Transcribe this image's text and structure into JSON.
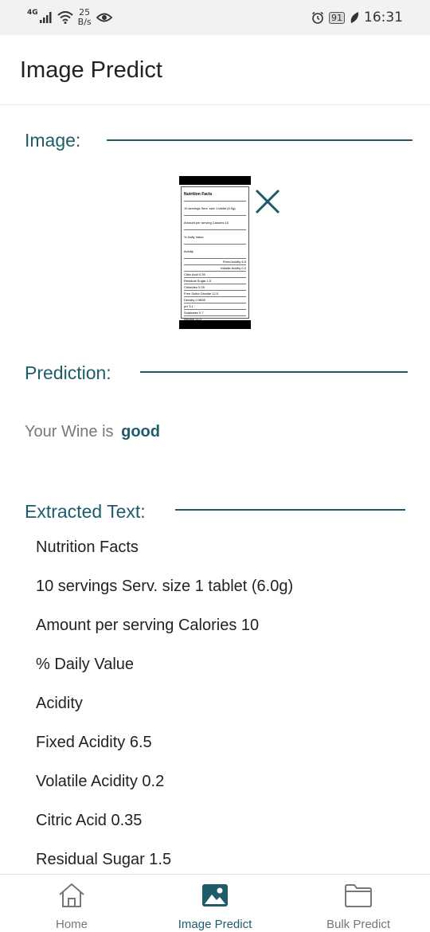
{
  "status_bar": {
    "network": "4G",
    "speed_value": "25",
    "speed_unit": "B/s",
    "battery": "91",
    "time": "16:31"
  },
  "app_bar": {
    "title": "Image Predict"
  },
  "image_section": {
    "title": "Image:",
    "receipt_lines": [
      "Nutrition Facts",
      "10 servings  Serv. size 1 tablet (6.0g)",
      "Amount per serving  Calories  10",
      "% Daily Value",
      "Acidity",
      "Fixed Acidity  6.5",
      "Volatile Acidity  0.2",
      "Citric Acid  0.35",
      "Residual Sugar  1.5",
      "Chlorides  0.05",
      "Free Sulfur Dioxide  12.0",
      "Density  0.9898",
      "pH  3.1",
      "Sulphates  0.7",
      "Alcohol  11.0"
    ]
  },
  "prediction_section": {
    "title": "Prediction:",
    "prefix": "Your Wine is",
    "value": "good"
  },
  "extracted_section": {
    "title": "Extracted Text:",
    "lines": [
      "Nutrition Facts",
      "10 servings Serv. size 1 tablet (6.0g)",
      "Amount per serving Calories 10",
      "% Daily Value",
      "Acidity",
      "Fixed Acidity 6.5",
      "Volatile Acidity 0.2",
      "Citric Acid 0.35",
      "Residual Sugar 1.5"
    ]
  },
  "bottom_nav": {
    "items": [
      {
        "label": "Home",
        "icon": "home-icon",
        "active": false
      },
      {
        "label": "Image Predict",
        "icon": "image-icon",
        "active": true
      },
      {
        "label": "Bulk Predict",
        "icon": "folder-icon",
        "active": false
      }
    ]
  },
  "colors": {
    "accent": "#1f5c6a",
    "muted_text": "#777777"
  }
}
